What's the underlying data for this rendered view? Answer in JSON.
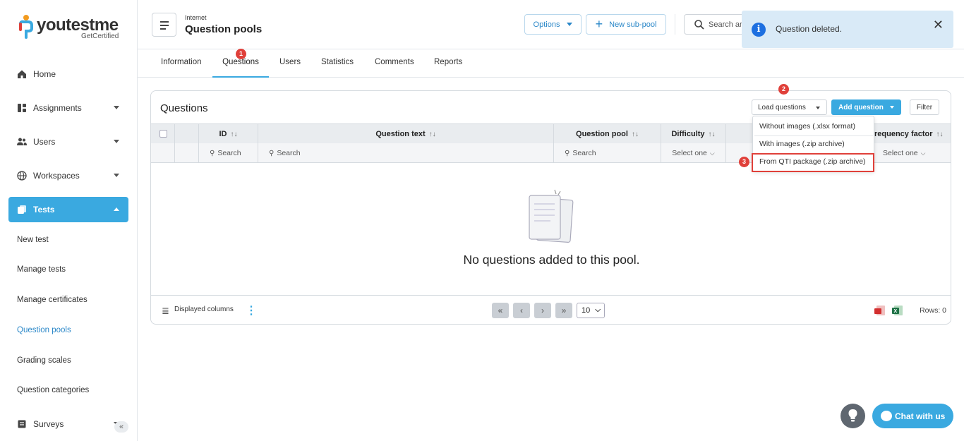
{
  "brand": {
    "name": "youtestme",
    "tagline": "GetCertified"
  },
  "sidebar": {
    "items": [
      {
        "label": "Home",
        "icon": "home-icon"
      },
      {
        "label": "Assignments",
        "icon": "assignments-icon"
      },
      {
        "label": "Users",
        "icon": "users-icon"
      },
      {
        "label": "Workspaces",
        "icon": "globe-icon"
      },
      {
        "label": "Tests",
        "icon": "tests-icon"
      }
    ],
    "sub_items": [
      "New test",
      "Manage tests",
      "Manage certificates",
      "Question pools",
      "Grading scales",
      "Question categories"
    ],
    "surveys_label": "Surveys",
    "collapse_symbol": "«"
  },
  "header": {
    "breadcrumb": "Internet",
    "title": "Question pools",
    "options_label": "Options",
    "new_subpool_label": "New sub-pool",
    "search_placeholder": "Search ar"
  },
  "tabs": [
    "Information",
    "Questions",
    "Users",
    "Statistics",
    "Comments",
    "Reports"
  ],
  "step_badges": [
    "1",
    "2",
    "3"
  ],
  "questions": {
    "title": "Questions",
    "load_label": "Load questions",
    "add_label": "Add question",
    "filter_label": "Filter",
    "columns": [
      "ID",
      "Question text",
      "Question pool",
      "Difficulty",
      "requency factor"
    ],
    "filters": {
      "search": "Search",
      "select": "Select one"
    },
    "sort_symbol": "↑↓",
    "empty_message": "No questions added to this pool.",
    "displayed_columns_label": "Displayed columns",
    "page_size": "10",
    "rows_label": "Rows: 0"
  },
  "load_menu": {
    "items": [
      "Without images (.xlsx format)",
      "With images (.zip archive)",
      "From QTI package (.zip archive)"
    ]
  },
  "toast": {
    "message": "Question deleted.",
    "icon_glyph": "i",
    "close_glyph": "✕"
  },
  "chat": {
    "label": "Chat with us"
  },
  "colors": {
    "accent": "#3aa9e0",
    "badge": "#e0403a",
    "toast_bg": "#d9eaf7"
  }
}
